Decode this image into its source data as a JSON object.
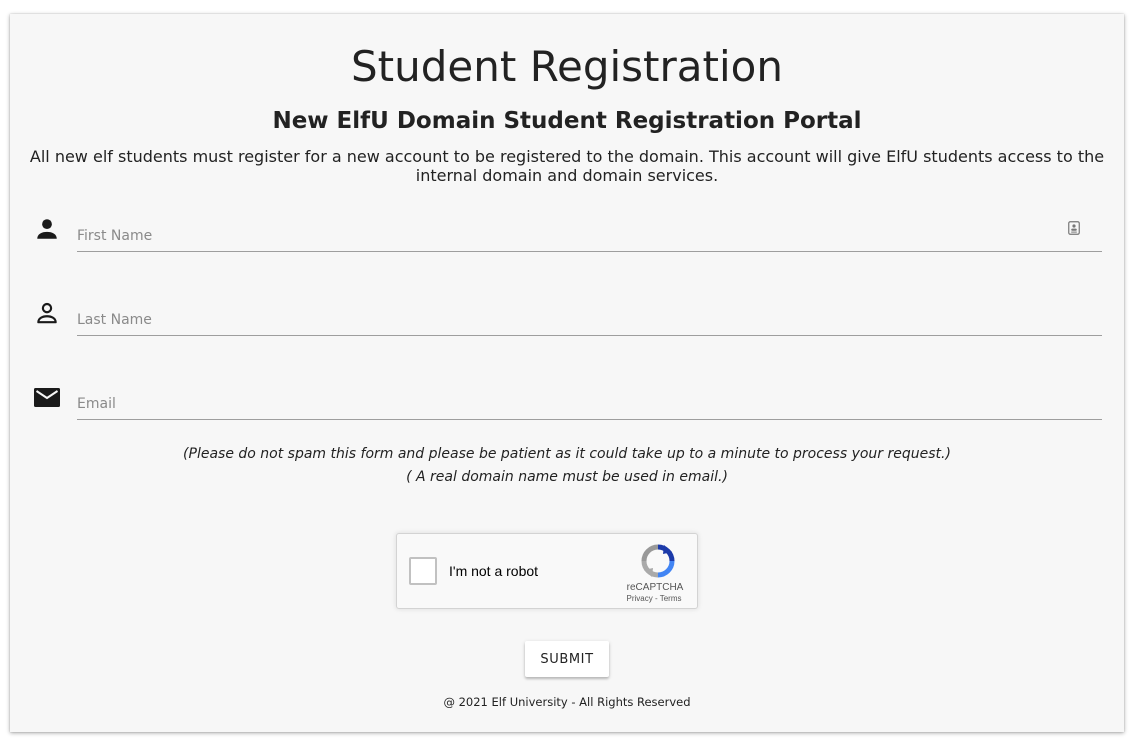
{
  "page": {
    "title": "Student Registration",
    "subtitle": "New ElfU Domain Student Registration Portal",
    "description": "All new elf students must register for a new account to be registered to the domain. This account will give ElfU students access to the internal domain and domain services."
  },
  "form": {
    "first_name": {
      "placeholder": "First Name",
      "value": "",
      "icon": "person-icon"
    },
    "last_name": {
      "placeholder": "Last Name",
      "value": "",
      "icon": "person-outline-icon"
    },
    "email": {
      "placeholder": "Email",
      "value": "",
      "icon": "mail-icon"
    }
  },
  "notes": {
    "spam_notice": "(Please do not spam this form and please be patient as it could take up to a minute to process your request.)",
    "domain_notice": "( A real domain name must be used in email.)"
  },
  "captcha": {
    "label": "I'm not a robot",
    "brand": "reCAPTCHA",
    "privacy_link": "Privacy",
    "separator": " - ",
    "terms_link": "Terms",
    "checked": false
  },
  "submit_label": "SUBMIT",
  "footer": "@ 2021 Elf University - All Rights Reserved",
  "colors": {
    "card_background": "#f7f7f7",
    "text": "#212121",
    "underline": "#9e9e9e",
    "captcha_blue": "#4a90e2"
  }
}
